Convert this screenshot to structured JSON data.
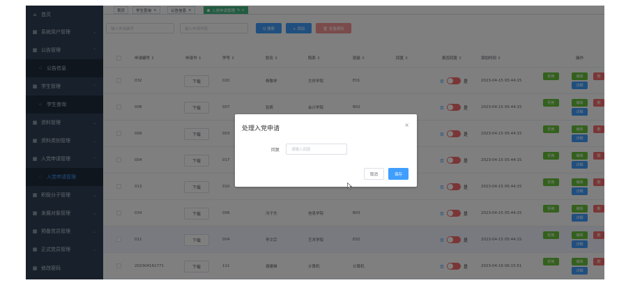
{
  "sidebar": {
    "items": [
      {
        "label": "首页",
        "icon": "home-icon",
        "glyph": "⌂",
        "chevron": ""
      },
      {
        "label": "系统用户管理",
        "icon": "grid-icon",
        "glyph": "▦",
        "chevron": "⌄"
      },
      {
        "label": "公告管理",
        "icon": "grid-icon",
        "glyph": "▦",
        "chevron": "⌃"
      },
      {
        "label": "公告信息",
        "icon": "apps-icon",
        "glyph": "⁘",
        "chevron": ""
      },
      {
        "label": "学生管理",
        "icon": "grid-icon",
        "glyph": "▦",
        "chevron": "⌃"
      },
      {
        "label": "学生查询",
        "icon": "apps-icon",
        "glyph": "⁘",
        "chevron": ""
      },
      {
        "label": "资料管理",
        "icon": "grid-icon",
        "glyph": "▦",
        "chevron": "⌄"
      },
      {
        "label": "资料类别管理",
        "icon": "grid-icon",
        "glyph": "▦",
        "chevron": "⌄"
      },
      {
        "label": "入党申请管理",
        "icon": "grid-icon",
        "glyph": "▦",
        "chevron": "⌃"
      },
      {
        "label": "入党申请管理",
        "icon": "apps-icon",
        "glyph": "⁘",
        "chevron": ""
      },
      {
        "label": "积极分子管理",
        "icon": "grid-icon",
        "glyph": "▦",
        "chevron": "⌄"
      },
      {
        "label": "发展对象管理",
        "icon": "grid-icon",
        "glyph": "▦",
        "chevron": "⌄"
      },
      {
        "label": "预备党员管理",
        "icon": "grid-icon",
        "glyph": "▦",
        "chevron": "⌄"
      },
      {
        "label": "正式党员管理",
        "icon": "grid-icon",
        "glyph": "▦",
        "chevron": "⌄"
      },
      {
        "label": "修改密码",
        "icon": "grid-icon",
        "glyph": "▦",
        "chevron": ""
      }
    ]
  },
  "tabs": [
    {
      "label": "首页",
      "close": ""
    },
    {
      "label": "学生查询",
      "close": "×"
    },
    {
      "label": "公告信息",
      "close": "×"
    },
    {
      "label": "入党申请管理",
      "close": "↻ ×"
    }
  ],
  "toolbar": {
    "input1_placeholder": "输入申请编号",
    "input2_placeholder": "输入申请学院",
    "search_label": "Q 搜索",
    "add_label": "+ 添加",
    "batch_delete_label": "🗑 批量删除"
  },
  "table": {
    "headers": [
      "申请编号 ⇕",
      "申请书 ⇕",
      "学号 ⇕",
      "姓名 ⇕",
      "院系 ⇕",
      "班级 ⇕",
      "回复 ⇕",
      "是否回复 ⇕",
      "添加时间 ⇕",
      "操作"
    ],
    "download_label": "下载",
    "switch_off": "否",
    "switch_on": "是",
    "op_labels": {
      "reject": "拒绝",
      "edit": "编辑",
      "detail": "详细",
      "delete": "删"
    },
    "rows": [
      {
        "id": "032",
        "sno": "020",
        "name": "杨敬祥",
        "dept": "文传学院",
        "cls": "E01",
        "reply": "",
        "time": "2023-04-15 05:44:15"
      },
      {
        "id": "008",
        "sno": "007",
        "name": "张燕",
        "dept": "会计学院",
        "cls": "B02",
        "reply": "",
        "time": "2023-04-15 05:44:15"
      },
      {
        "id": "009",
        "sno": "003",
        "name": "",
        "dept": "",
        "cls": "",
        "reply": "",
        "time": "2023-04-15 05:44:15"
      },
      {
        "id": "004",
        "sno": "017",
        "name": "",
        "dept": "",
        "cls": "",
        "reply": "",
        "time": "2023-04-15 05:44:15"
      },
      {
        "id": "013",
        "sno": "010",
        "name": "",
        "dept": "",
        "cls": "",
        "reply": "",
        "time": "2023-04-15 05:44:15"
      },
      {
        "id": "034",
        "sno": "006",
        "name": "冯子杰",
        "dept": "信息学院",
        "cls": "B03",
        "reply": "",
        "time": "2023-04-15 05:44:15"
      },
      {
        "id": "011",
        "sno": "004",
        "name": "李文宗",
        "dept": "艺术学院",
        "cls": "E02",
        "reply": "",
        "time": "2023-04-15 05:44:15"
      },
      {
        "id": "202304161771",
        "sno": "111",
        "name": "谢建雄",
        "dept": "计算机",
        "cls": "计算机",
        "reply": "",
        "time": "2023-04-16 06:15:51"
      }
    ]
  },
  "dialog": {
    "title": "处理入党申请",
    "close": "×",
    "reply_label": "回复",
    "reply_placeholder": "请输入回复",
    "cancel_label": "取消",
    "save_label": "保存"
  },
  "colors": {
    "sidebar_bg": "#304156",
    "primary": "#409eff",
    "success": "#67c23a",
    "danger": "#f56c6c",
    "tab_active": "#42b983"
  }
}
